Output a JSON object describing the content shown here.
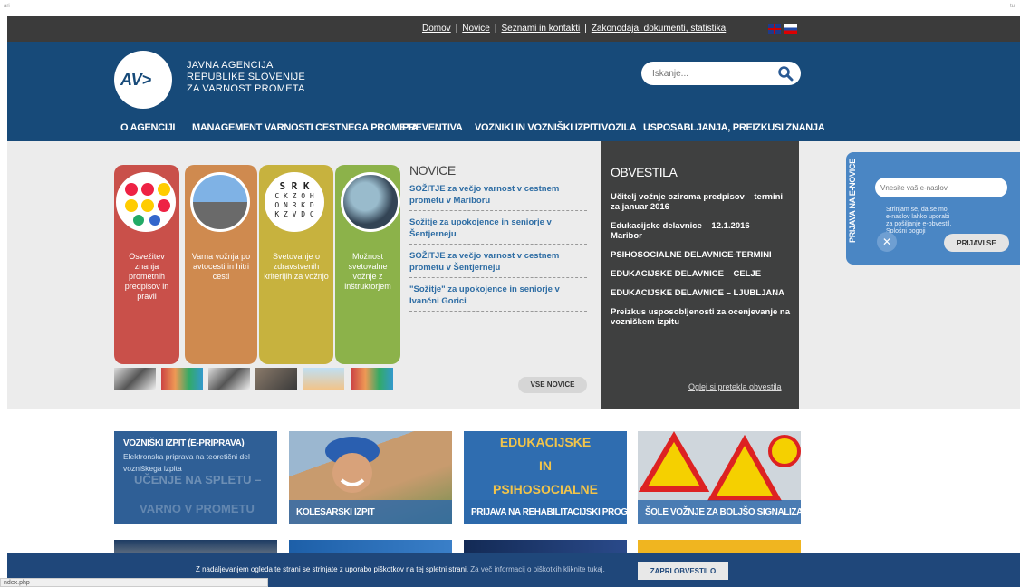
{
  "browser": {
    "left_text": "ari",
    "right_text": "tu"
  },
  "topnav": {
    "links": [
      "Domov",
      "Novice",
      "Seznami in kontakti",
      "Zakonodaja, dokumenti, statistika"
    ]
  },
  "header": {
    "agency_lines": [
      "JAVNA AGENCIJA",
      "REPUBLIKE SLOVENIJE",
      "ZA VARNOST PROMETA"
    ],
    "logo_text": "AV>",
    "search_placeholder": "Iskanje..."
  },
  "mainnav": [
    "O AGENCIJI",
    "MANAGEMENT VARNOSTI CESTNEGA PROMETA",
    "PREVENTIVA",
    "VOZNIKI IN VOZNIŠKI IZPITI",
    "VOZILA",
    "USPOSABLJANJA, PREIZKUSI ZNANJA"
  ],
  "slider": {
    "items": [
      {
        "text": "Osvežitev znanja prometnih predpisov in pravil",
        "color": "#c9504a"
      },
      {
        "text": "Varna vožnja po avtocesti in hitri cesti",
        "color": "#cf8a4f"
      },
      {
        "text": "Svetovanje o zdravstvenih kriterijih za vožnjo",
        "color": "#c7b23e"
      },
      {
        "text": "Možnost svetovalne vožnje z inštruktorjem",
        "color": "#8cb24a"
      }
    ]
  },
  "news": {
    "title": "NOVICE",
    "items": [
      "SOŽITJE za večjo varnost v cestnem prometu v Mariboru",
      "Sožitje za upokojence in seniorje v Šentjerneju",
      "SOŽITJE za večjo varnost v cestnem prometu v Šentjerneju",
      "\"Sožitje\" za upokojence in seniorje v Ivančni Gorici"
    ],
    "all_button": "VSE NOVICE"
  },
  "obvestila": {
    "title": "OBVESTILA",
    "items": [
      "Učitelj vožnje oziroma predpisov – termini za januar 2016",
      "Edukacijske delavnice – 12.1.2016 – Maribor",
      "PSIHOSOCIALNE DELAVNICE-TERMINI",
      "EDUKACIJSKE DELAVNICE – CELJE",
      "EDUKACIJSKE DELAVNICE – LJUBLJANA",
      "Preizkus usposobljenosti za ocenjevanje na vozniškem izpitu"
    ],
    "link": "Oglej si pretekla obvestila"
  },
  "enovice": {
    "label": "PRIJAVA NA E-NOVICE",
    "input_placeholder": "Vnesite vaš e-naslov",
    "consent": "Strinjam se, da se moj e-naslov lahko uporabi za pošiljanje e-obvestil. Splošni pogoji",
    "close": "✕",
    "button": "PRIJAVI SE"
  },
  "tiles": [
    {
      "caption": "",
      "title": "VOZNIŠKI IZPIT (E-PRIPRAVA)",
      "subtitle": "Elektronska priprava na teoretični del vozniškega izpita",
      "watermark1": "UČENJE NA SPLETU –",
      "watermark2": "VARNO V PROMETU"
    },
    {
      "caption": "KOLESARSKI IZPIT"
    },
    {
      "caption": "PRIJAVA NA REHABILITACIJSKI PROGRAM",
      "big1": "EDUKACIJSKE",
      "big2": "IN",
      "big3": "PSIHOSOCIALNE"
    },
    {
      "caption": "ŠOLE VOŽNJE ZA BOLJŠO SIGNALIZACIJO"
    }
  ],
  "cookie": {
    "message": "Z nadaljevanjem ogleda te strani se strinjate z uporabo piškotkov na tej spletni strani.",
    "more": "Za več informacij o piškotkih kliknite tukaj.",
    "button": "ZAPRI OBVESTILO"
  },
  "statusbar": "ndex.php"
}
